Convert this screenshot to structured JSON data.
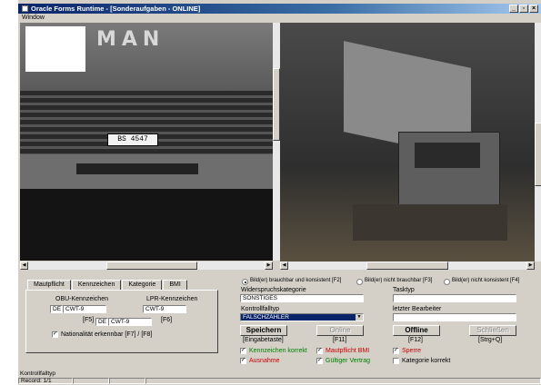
{
  "window": {
    "title": "Oracle Forms Runtime - [Sonderaufgaben - ONLINE]"
  },
  "menubar": {
    "items": [
      "Window"
    ]
  },
  "images": {
    "left": {
      "plate": "BS 4547",
      "brand": "MAN"
    }
  },
  "tabs": [
    "Mautpflicht",
    "Kennzeichen",
    "Kategorie",
    "BMI"
  ],
  "kennzeichen": {
    "obu_label": "OBU-Kennzeichen",
    "lpr_label": "LPR-Kennzeichen",
    "obu_country": "DE",
    "obu_plate": "CWT-9",
    "lpr_plate": "CWT-9",
    "f5": "[F5]",
    "f6": "[F6]",
    "edit_country": "DE",
    "edit_plate": "CWT-9",
    "nat_label": "Nationalität erkennbar [F7] / [F8]"
  },
  "radios": [
    {
      "label": "Bild(er) brauchbar und konsistent [F2]",
      "checked": true
    },
    {
      "label": "Bild(er) nicht brauchbar [F3]",
      "checked": false
    },
    {
      "label": "Bild(er) nicht konsistent [F4]",
      "checked": false
    }
  ],
  "form": {
    "widerspruch_label": "Widerspruchskategorie",
    "widerspruch_value": "SONSTIGES",
    "tasktyp_label": "Tasktyp",
    "tasktyp_value": "",
    "kontrollfall_label": "Kontrollfalltyp",
    "kontrollfall_value": "FALSCHZÄHLER",
    "bearbeiter_label": "letzter Bearbeiter",
    "bearbeiter_value": ""
  },
  "buttons": {
    "speichern": "Speichern",
    "speichern_key": "[Eingabetaste]",
    "online": "Online",
    "online_key": "[F11]",
    "offline": "Offline",
    "offline_key": "[F12]",
    "schliessen": "Schließen",
    "schliessen_key": "[Strg+Q]"
  },
  "checks": [
    {
      "label": "Kennzeichen korrekt",
      "checked": true,
      "color": "#008000"
    },
    {
      "label": "Mautpflicht BMI",
      "checked": true,
      "color": "#cc0000"
    },
    {
      "label": "Sperre",
      "checked": true,
      "color": "#cc0000"
    },
    {
      "label": "Ausnahme",
      "checked": true,
      "color": "#cc0000"
    },
    {
      "label": "Gültiger Vertrag",
      "checked": true,
      "color": "#008000"
    },
    {
      "label": "Kategorie korrekt",
      "checked": false,
      "color": "#000000"
    }
  ],
  "status": {
    "line1": "Kontrollfalltyp",
    "line2": "Record: 1/1"
  }
}
